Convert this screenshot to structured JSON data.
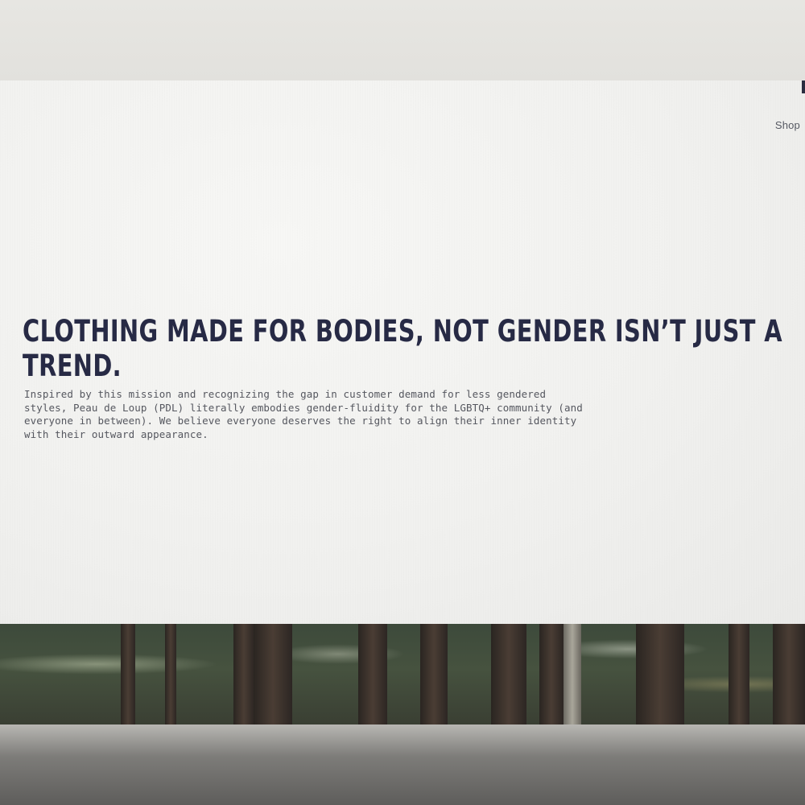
{
  "nav": {
    "shop_label": "Shop"
  },
  "hero": {
    "headline": "CLOTHING MADE FOR BODIES, NOT GENDER ISN’T JUST A TREND.",
    "body": "Inspired by this mission and recognizing the gap in customer demand for less gendered styles, Peau de Loup (PDL) literally embodies gender-fluidity for the LGBTQ+ community (and everyone in between). We believe everyone deserves the right to align their inner identity with their outward appearance."
  },
  "colors": {
    "headline": "#272a45",
    "body_text": "#55575f",
    "page_background": "#f1f1ef"
  }
}
